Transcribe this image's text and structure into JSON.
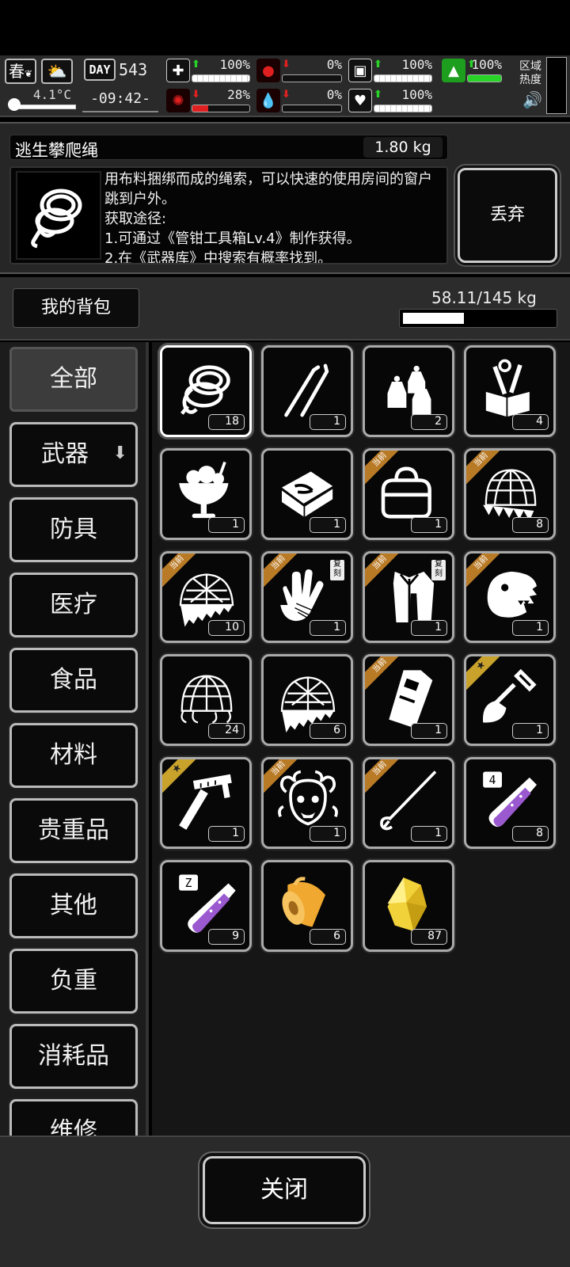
{
  "hud": {
    "season": "春",
    "temperature": "4.1°C",
    "day_label": "DAY",
    "day_number": "543",
    "time": "-09:42-",
    "stats": [
      {
        "key": "health",
        "icon": "medkit-icon",
        "glyph": "✚",
        "trend": "up",
        "value": "100%",
        "fill": 1.0,
        "color": "#ffffff"
      },
      {
        "key": "hunger",
        "icon": "stomach-icon",
        "glyph": "●",
        "trend": "down",
        "value": "0%",
        "fill": 0.0,
        "color": "#e02020"
      },
      {
        "key": "armor",
        "icon": "vest-icon",
        "glyph": "▣",
        "trend": "up",
        "value": "100%",
        "fill": 1.0,
        "color": "#ffffff"
      },
      {
        "key": "stamina",
        "icon": "boot-icon",
        "glyph": "▲",
        "trend": "up",
        "value": "100%",
        "fill": 1.0,
        "color": "#28d428"
      },
      {
        "key": "brain",
        "icon": "brain-icon",
        "glyph": "✺",
        "trend": "down",
        "value": "28%",
        "fill": 0.28,
        "color": "#e02020"
      },
      {
        "key": "thirst",
        "icon": "water-drop-icon",
        "glyph": "💧",
        "trend": "down",
        "value": "0%",
        "fill": 0.0,
        "color": "#e02020"
      },
      {
        "key": "mood",
        "icon": "heart-icon",
        "glyph": "♥",
        "trend": "up",
        "value": "100%",
        "fill": 1.0,
        "color": "#ffffff"
      }
    ],
    "zone_label_line1": "区域",
    "zone_label_line2": "热度"
  },
  "detail": {
    "item_name": "逃生攀爬绳",
    "item_weight": "1.80 kg",
    "description": "用布料捆绑而成的绳索，可以快速的使用房间的窗户跳到户外。\n获取途径:\n1.可通过《管钳工具箱Lv.4》制作获得。\n2.在《武器库》中搜索有概率找到。",
    "discard_label": "丢弃"
  },
  "bag": {
    "title": "我的背包",
    "capacity_text": "58.11/145 kg",
    "capacity_fraction": 0.4008
  },
  "categories": [
    {
      "label": "全部",
      "selected": true
    },
    {
      "label": "武器",
      "selected": false,
      "has_arrow": true
    },
    {
      "label": "防具",
      "selected": false
    },
    {
      "label": "医疗",
      "selected": false
    },
    {
      "label": "食品",
      "selected": false
    },
    {
      "label": "材料",
      "selected": false
    },
    {
      "label": "贵重品",
      "selected": false
    },
    {
      "label": "其他",
      "selected": false
    },
    {
      "label": "负重",
      "selected": false
    },
    {
      "label": "消耗品",
      "selected": false
    },
    {
      "label": "维修",
      "selected": false
    }
  ],
  "badge_text": "当前",
  "copy_mark_text": "复刻",
  "items": [
    {
      "name": "rope-coil",
      "count": "18",
      "badge": null,
      "selected": true
    },
    {
      "name": "lockpicks",
      "count": "1",
      "badge": null
    },
    {
      "name": "bells",
      "count": "2",
      "badge": null
    },
    {
      "name": "toolkit",
      "count": "4",
      "badge": null
    },
    {
      "name": "ice-cream-sundae",
      "count": "1",
      "badge": null
    },
    {
      "name": "pliers-toolbox",
      "count": "1",
      "badge": null
    },
    {
      "name": "duffel-bag",
      "count": "1",
      "badge": "cur"
    },
    {
      "name": "net-trap",
      "count": "8",
      "badge": "cur"
    },
    {
      "name": "spiked-net",
      "count": "10",
      "badge": "cur"
    },
    {
      "name": "gloves",
      "count": "1",
      "badge": "cur",
      "mark": true
    },
    {
      "name": "coat",
      "count": "1",
      "badge": "cur",
      "mark": true
    },
    {
      "name": "dino-mask",
      "count": "1",
      "badge": "cur"
    },
    {
      "name": "net-trap-large",
      "count": "24",
      "badge": null
    },
    {
      "name": "spiked-net-small",
      "count": "6",
      "badge": null
    },
    {
      "name": "walkie-talkie",
      "count": "1",
      "badge": "cur"
    },
    {
      "name": "shovel",
      "count": "1",
      "badge": "star"
    },
    {
      "name": "caliper-knife",
      "count": "1",
      "badge": "star"
    },
    {
      "name": "medusa-mask",
      "count": "1",
      "badge": "cur"
    },
    {
      "name": "spear",
      "count": "1",
      "badge": "cur"
    },
    {
      "name": "test-tube-4",
      "count": "8",
      "badge": null
    },
    {
      "name": "test-tube-z",
      "count": "9",
      "badge": null
    },
    {
      "name": "fabric-roll",
      "count": "6",
      "badge": null
    },
    {
      "name": "gold-crystal",
      "count": "87",
      "badge": null
    }
  ],
  "close_label": "关闭"
}
